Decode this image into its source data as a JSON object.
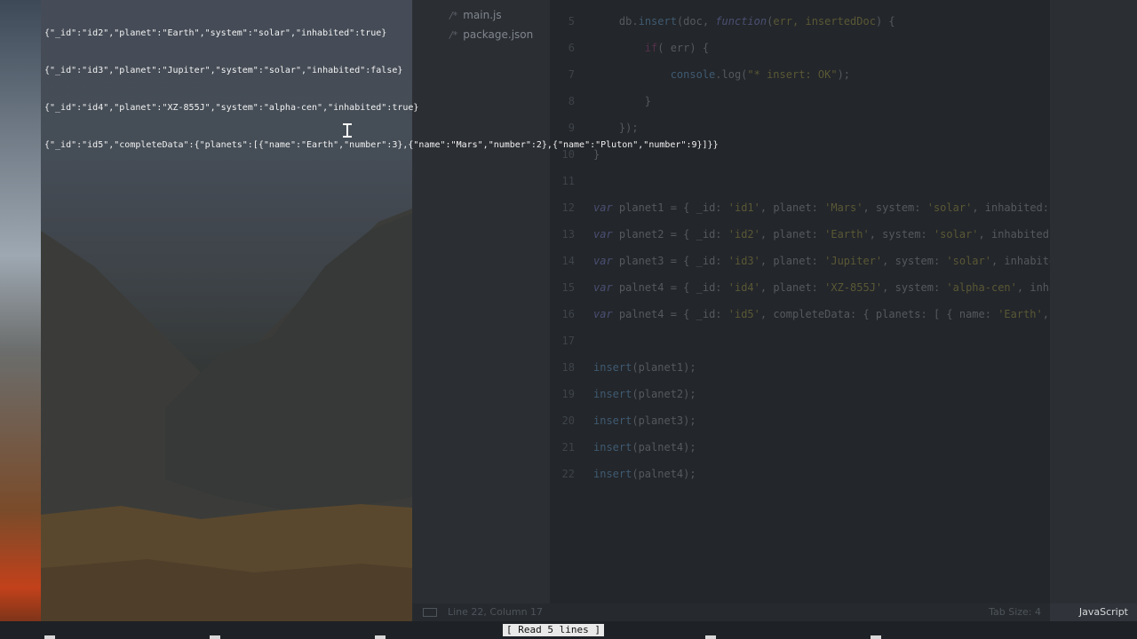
{
  "terminal": {
    "lines": [
      "{\"_id\":\"id2\",\"planet\":\"Earth\",\"system\":\"solar\",\"inhabited\":true}",
      "{\"_id\":\"id3\",\"planet\":\"Jupiter\",\"system\":\"solar\",\"inhabited\":false}",
      "{\"_id\":\"id4\",\"planet\":\"XZ-855J\",\"system\":\"alpha-cen\",\"inhabited\":true}",
      "{\"_id\":\"id5\",\"completeData\":{\"planets\":[{\"name\":\"Earth\",\"number\":3},{\"name\":\"Mars\",\"number\":2},{\"name\":\"Pluton\",\"number\":9}]}}"
    ],
    "status_message": "[ Read 5 lines ]"
  },
  "sidebar": {
    "files": [
      {
        "icon": "/*",
        "name": "main.js"
      },
      {
        "icon": "/*",
        "name": "package.json"
      }
    ]
  },
  "editor": {
    "line_numbers": [
      "5",
      "6",
      "7",
      "8",
      "9",
      "10",
      "11",
      "12",
      "13",
      "14",
      "15",
      "16",
      "17",
      "18",
      "19",
      "20",
      "21",
      "22"
    ],
    "status": {
      "position": "Line 22, Column 17",
      "tab_size": "Tab Size: 4",
      "language": "JavaScript"
    }
  }
}
